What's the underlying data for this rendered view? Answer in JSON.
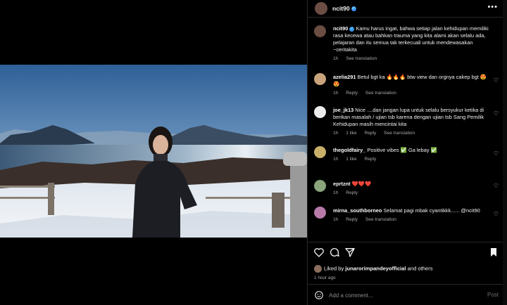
{
  "post": {
    "username": "ncit90",
    "caption": "Kamu harus ingat, bahwa setiap jalan kehidupan memiliki rasa kecewa atau bahkan trauma yang kita alami akan selalu ada, pelajaran dan itu semua tak terkecuali untuk mendewasakan ~ceritakita",
    "caption_time": "1h",
    "see_translation": "See translation"
  },
  "comments": [
    {
      "user": "azelia291",
      "text": "Betul bgt ka 🔥🔥🔥 btw view dan orgnya cakep bgt 😍😍",
      "time": "1h",
      "likes": "",
      "reply": "Reply",
      "translate": "See translation"
    },
    {
      "user": "joe_jk13",
      "text": "Nice ....dan jangan lupa untuk selalu bersyukur ketika di berikan masalah / ujian tsb karena dengan ujian tsb Sang Pemilik Kehidupan masih mencintai kita",
      "time": "1h",
      "likes": "1 like",
      "reply": "Reply",
      "translate": "See translation"
    },
    {
      "user": "thegoldfairy_",
      "text": "Positive vibes ✅ Ga lebay ✅",
      "time": "1h",
      "likes": "1 like",
      "reply": "Reply",
      "translate": ""
    },
    {
      "user": "eprtznt",
      "text": "❤️❤️❤️",
      "time": "1h",
      "likes": "",
      "reply": "Reply",
      "translate": ""
    },
    {
      "user": "mirna_southborneo",
      "text": "Selamat pagi mbak cyantikkk...... @ncit90",
      "time": "1h",
      "likes": "",
      "reply": "Reply",
      "translate": "See translation"
    }
  ],
  "likes": {
    "prefix": "Liked by",
    "user": "junarorimpandeyofficial",
    "suffix": "and others"
  },
  "time_ago": "1 hour ago",
  "add_comment": {
    "placeholder": "Add a comment...",
    "post_label": "Post"
  },
  "colors": {
    "verified": "#3897f0",
    "muted": "#a8a8a8"
  }
}
